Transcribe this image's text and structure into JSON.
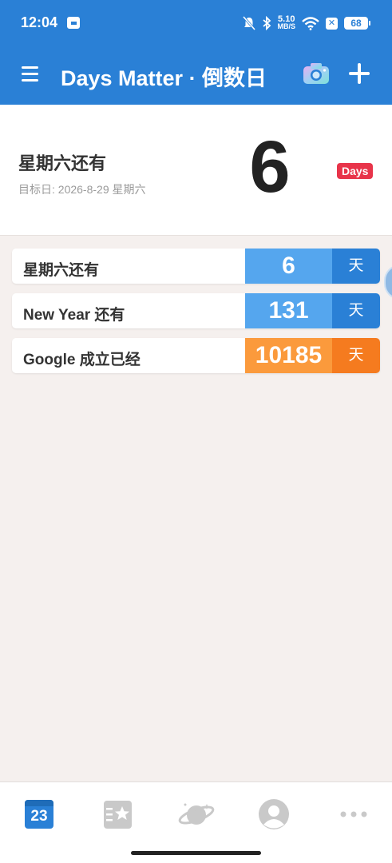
{
  "status_bar": {
    "time": "12:04",
    "net_speed_value": "5.10",
    "net_speed_unit": "MB/S",
    "battery": "68"
  },
  "app_bar": {
    "title": "Days Matter · 倒数日"
  },
  "hero": {
    "title": "星期六还有",
    "target_date": "目标日: 2026-8-29 星期六",
    "count": "6",
    "unit_badge": "Days"
  },
  "events": [
    {
      "label": "星期六还有",
      "count": "6",
      "unit": "天",
      "num_color": "#55a6ee",
      "unit_color": "#2a80d6"
    },
    {
      "label": "New Year 还有",
      "count": "131",
      "unit": "天",
      "num_color": "#55a6ee",
      "unit_color": "#2a80d6"
    },
    {
      "label": "Google 成立已经",
      "count": "10185",
      "unit": "天",
      "num_color": "#fb9a3c",
      "unit_color": "#f57b1f"
    }
  ],
  "bottom_nav": {
    "calendar_day": "23",
    "items": [
      "calendar-icon",
      "star-list-icon",
      "planet-icon",
      "avatar-icon",
      "more-icon"
    ]
  },
  "colors": {
    "primary": "#2a80d6",
    "badge_red": "#e8344a",
    "background": "#f5f0ee"
  }
}
